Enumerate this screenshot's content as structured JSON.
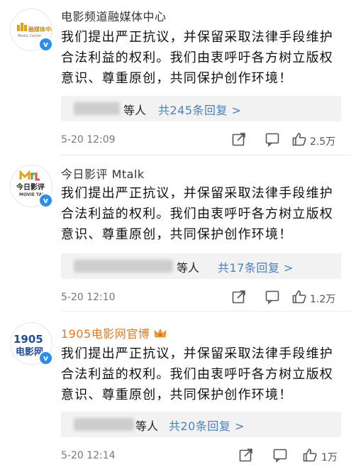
{
  "comments": [
    {
      "name": "电影频道融媒体中心",
      "avatar_text": "融媒体中心",
      "avatar_subtext": "Media Center",
      "body": "我们提出严正抗议，并保留采取法律手段维护合法利益的权利。我们由衷呼吁各方树立版权意识、尊重原创，共同保护创作环境！",
      "reply_who": "等人",
      "reply_count": "共245条回复 >",
      "time": "5-20 12:09",
      "likes": "2.5万"
    },
    {
      "name": "今日影评 Mtalk",
      "avatar_text": "今日影评",
      "avatar_subtext": "MOVIE TAL",
      "body": "我们提出严正抗议，并保留采取法律手段维护合法利益的权利。我们由衷呼吁各方树立版权意识、尊重原创，共同保护创作环境！",
      "reply_who": "等人",
      "reply_count": "共17条回复 >",
      "time": "5-20 12:10",
      "likes": "1.2万"
    },
    {
      "name": "1905电影网官博",
      "avatar_text": "1905",
      "avatar_subtext": "电影网",
      "body": "我们提出严正抗议，并保留采取法律手段维护合法利益的权利。我们由衷呼吁各方树立版权意识、尊重原创，共同保护创作环境！",
      "reply_who": "等人",
      "reply_count": "共20条回复 >",
      "time": "5-20 12:14",
      "likes": "1万"
    }
  ],
  "verified_mark": "v",
  "colors": {
    "link_blue": "#4a7fc1",
    "vip_orange": "#e6781e",
    "verified_blue": "#2f8dea"
  },
  "icons": [
    "share-icon",
    "comment-icon",
    "like-icon",
    "vip-crown-icon"
  ]
}
